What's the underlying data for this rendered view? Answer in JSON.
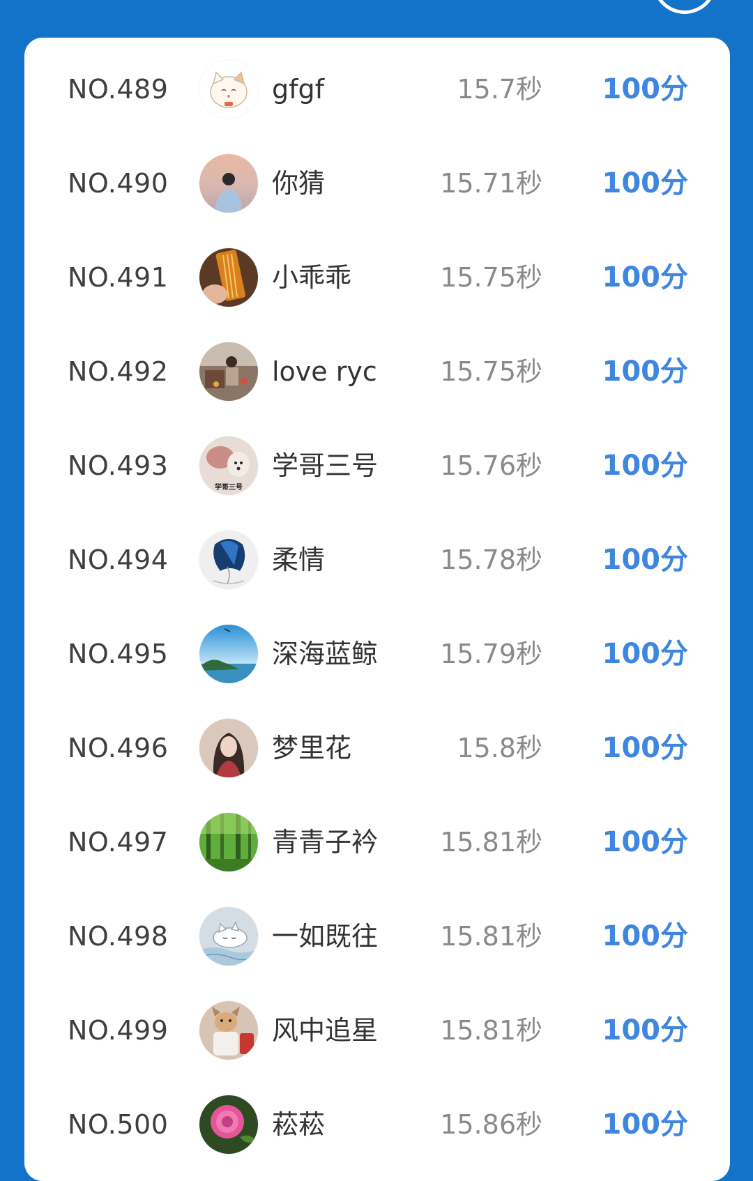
{
  "accent_color": "#1273c9",
  "score_color": "#3f86e0",
  "header": {
    "circle_icon": "circle-outline-icon"
  },
  "leaderboard": {
    "rows": [
      {
        "rank": "NO.489",
        "avatar": "cat-cartoon-avatar",
        "name": "gfgf",
        "time": "15.7秒",
        "score": "100分"
      },
      {
        "rank": "NO.490",
        "avatar": "boy-sunset-avatar",
        "name": "你猜",
        "time": "15.71秒",
        "score": "100分"
      },
      {
        "rank": "NO.491",
        "avatar": "snack-hand-avatar",
        "name": "小乖乖",
        "time": "15.75秒",
        "score": "100分"
      },
      {
        "rank": "NO.492",
        "avatar": "room-photo-avatar",
        "name": "love ryc",
        "time": "15.75秒",
        "score": "100分"
      },
      {
        "rank": "NO.493",
        "avatar": "cute-pet-avatar",
        "name": "学哥三号",
        "time": "15.76秒",
        "score": "100分",
        "avatar_caption": "学哥三号"
      },
      {
        "rank": "NO.494",
        "avatar": "blue-hair-sketch-avatar",
        "name": "柔情",
        "time": "15.78秒",
        "score": "100分"
      },
      {
        "rank": "NO.495",
        "avatar": "sea-island-avatar",
        "name": "深海蓝鲸",
        "time": "15.79秒",
        "score": "100分"
      },
      {
        "rank": "NO.496",
        "avatar": "girl-portrait-avatar",
        "name": "梦里花",
        "time": "15.8秒",
        "score": "100分"
      },
      {
        "rank": "NO.497",
        "avatar": "forest-avatar",
        "name": "青青子衿",
        "time": "15.81秒",
        "score": "100分"
      },
      {
        "rank": "NO.498",
        "avatar": "sleeping-cat-avatar",
        "name": "一如既往",
        "time": "15.81秒",
        "score": "100分"
      },
      {
        "rank": "NO.499",
        "avatar": "dog-avatar",
        "name": "风中追星",
        "time": "15.81秒",
        "score": "100分"
      },
      {
        "rank": "NO.500",
        "avatar": "pink-rose-avatar",
        "name": "菘菘",
        "time": "15.86秒",
        "score": "100分"
      }
    ]
  }
}
